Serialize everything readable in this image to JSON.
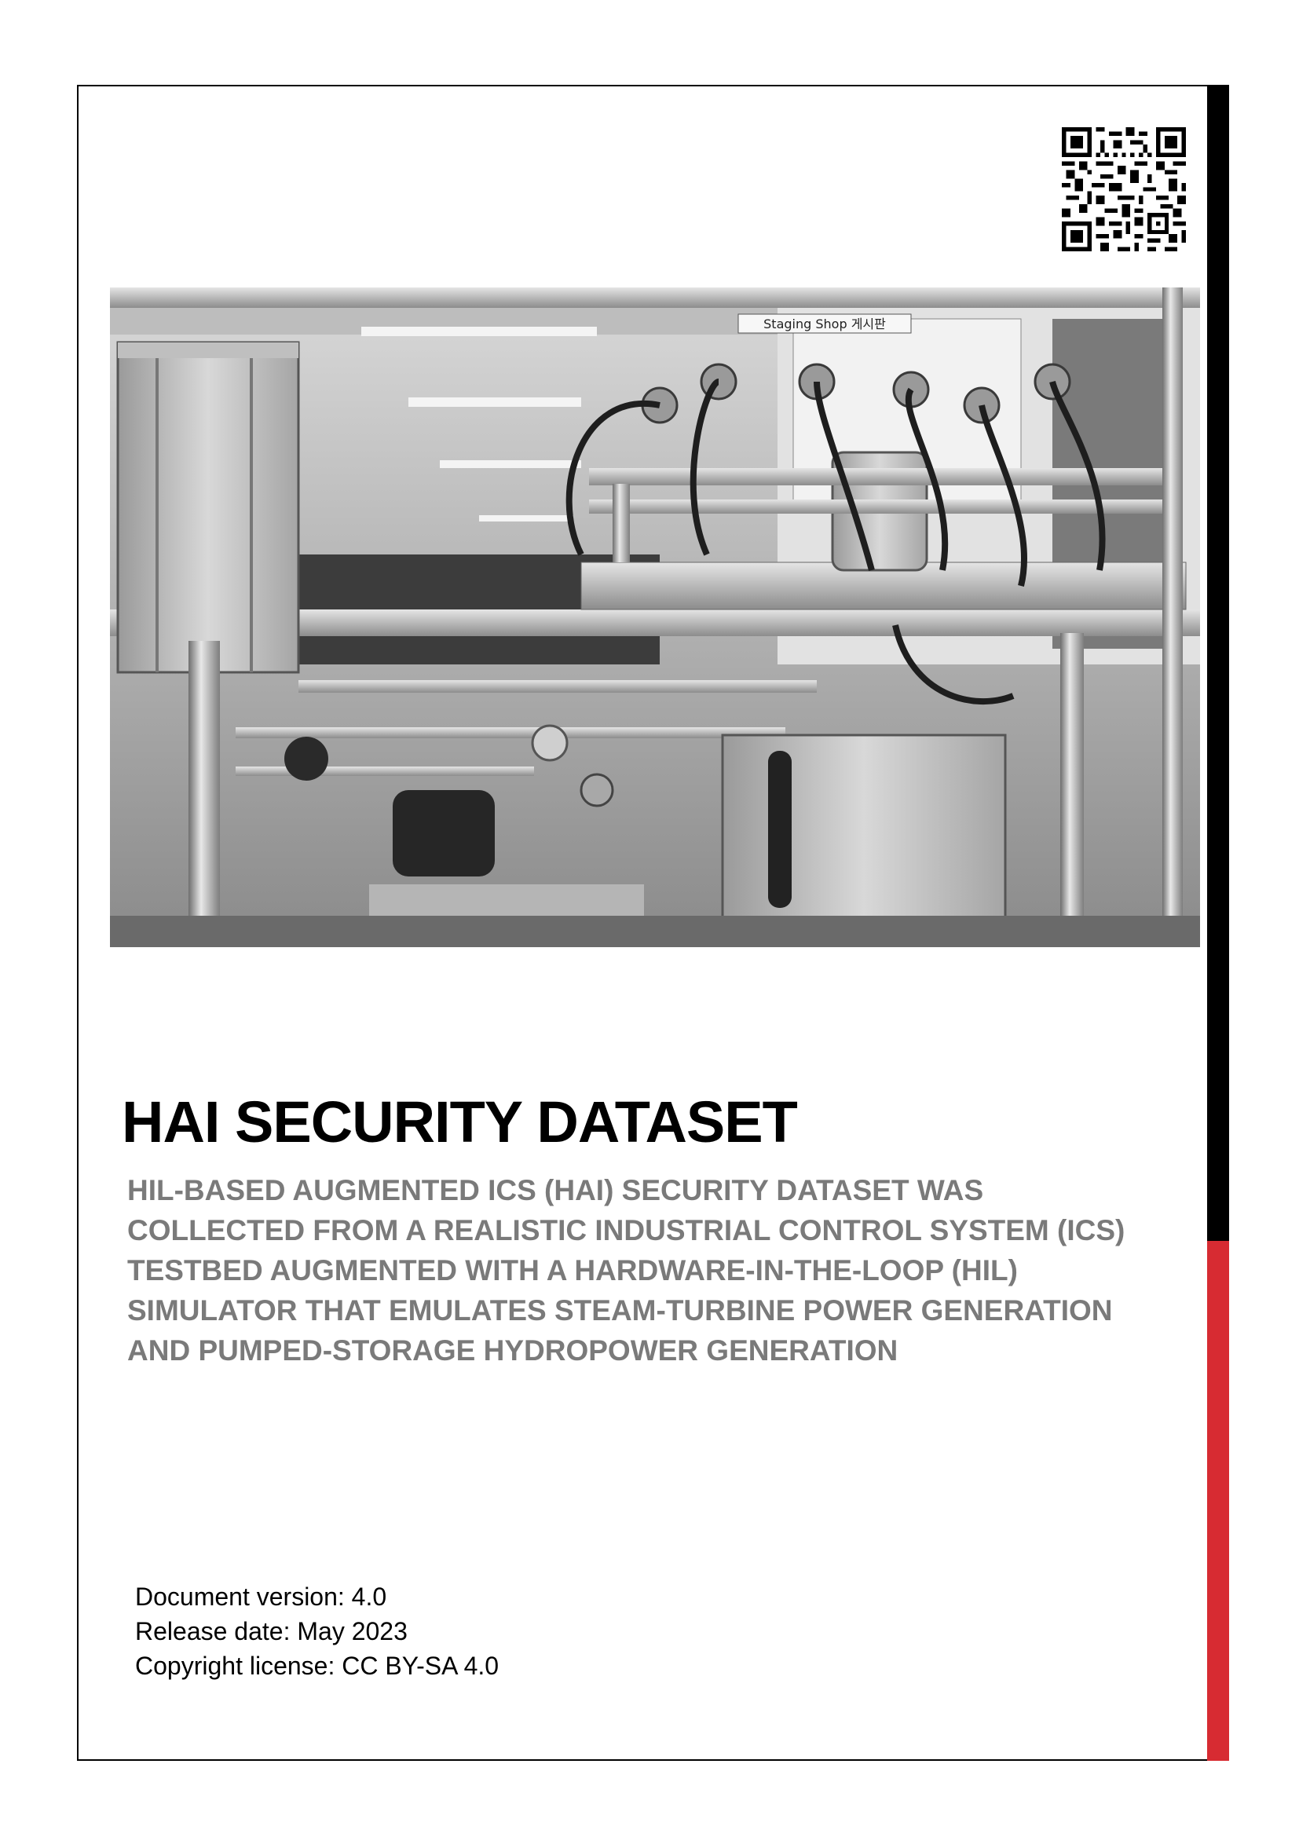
{
  "document": {
    "title": "HAI SECURITY DATASET",
    "subtitle_lines": [
      "HIL-BASED AUGMENTED ICS (HAI) SECURITY DATASET WAS",
      "COLLECTED FROM A REALISTIC INDUSTRIAL CONTROL SYSTEM (ICS)",
      "TESTBED AUGMENTED WITH A HARDWARE-IN-THE-LOOP (HIL)",
      "SIMULATOR THAT EMULATES STEAM-TURBINE POWER GENERATION",
      "AND PUMPED-STORAGE HYDROPOWER GENERATION"
    ],
    "meta": {
      "version": "Document version: 4.0",
      "release_date": "Release date: May 2023",
      "license": "Copyright license: CC BY-SA 4.0"
    }
  },
  "photo": {
    "sign_text": "Staging Shop 게시판",
    "description_icon": "testbed-photo"
  },
  "colors": {
    "accent_red": "#d72b32",
    "side_black": "#000000",
    "subtitle_gray": "#7a7a7a"
  },
  "icons": {
    "qr": "qr-code-icon"
  }
}
